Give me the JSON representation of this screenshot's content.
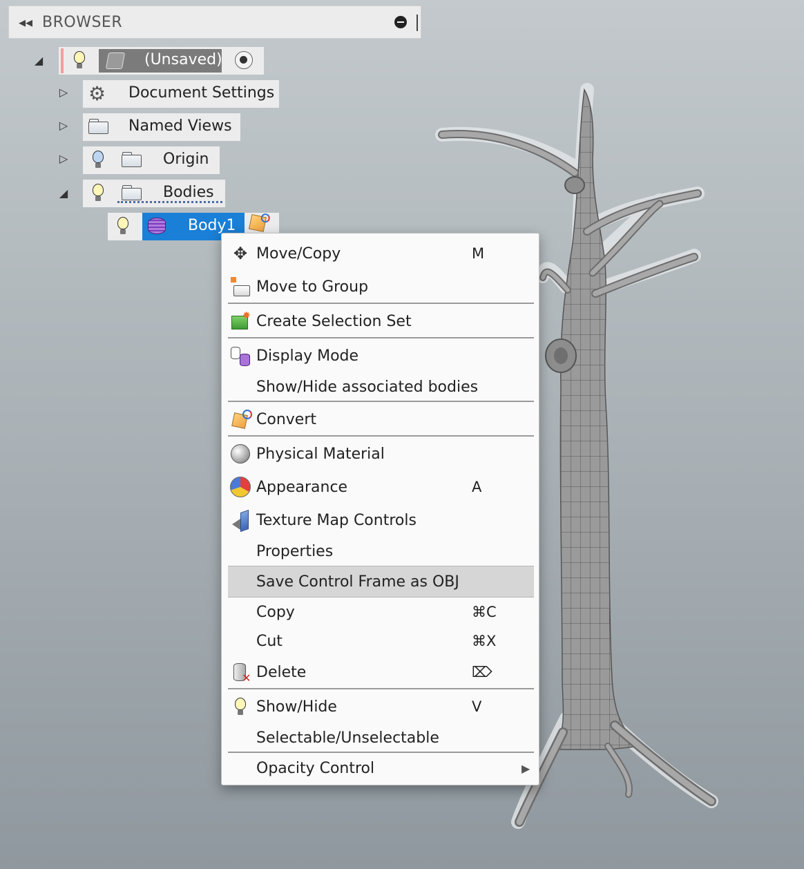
{
  "browser": {
    "collapse_icon": "◂◂",
    "title": "BROWSER"
  },
  "tree": {
    "root": {
      "label": "(Unsaved)"
    },
    "document_settings": {
      "label": "Document Settings"
    },
    "named_views": {
      "label": "Named Views"
    },
    "origin": {
      "label": "Origin"
    },
    "bodies": {
      "label": "Bodies"
    },
    "body1": {
      "label": "Body1"
    }
  },
  "menu": {
    "items": [
      {
        "label": "Move/Copy",
        "shortcut": "M",
        "icon": "move-icon"
      },
      {
        "label": "Move to Group",
        "shortcut": "",
        "icon": "move-to-group-icon"
      },
      {
        "label": "Create Selection Set",
        "shortcut": "",
        "icon": "selection-set-icon"
      },
      {
        "label": "Display Mode",
        "shortcut": "",
        "icon": "display-mode-icon"
      },
      {
        "label": "Show/Hide associated bodies",
        "shortcut": "",
        "icon": ""
      },
      {
        "label": "Convert",
        "shortcut": "",
        "icon": "convert-icon"
      },
      {
        "label": "Physical Material",
        "shortcut": "",
        "icon": "material-icon"
      },
      {
        "label": "Appearance",
        "shortcut": "A",
        "icon": "appearance-icon"
      },
      {
        "label": "Texture Map Controls",
        "shortcut": "",
        "icon": "texture-map-icon"
      },
      {
        "label": "Properties",
        "shortcut": "",
        "icon": ""
      },
      {
        "label": "Save Control Frame as OBJ",
        "shortcut": "",
        "icon": ""
      },
      {
        "label": "Copy",
        "shortcut": "⌘C",
        "icon": ""
      },
      {
        "label": "Cut",
        "shortcut": "⌘X",
        "icon": ""
      },
      {
        "label": "Delete",
        "shortcut": "⌦",
        "icon": "delete-icon"
      },
      {
        "label": "Show/Hide",
        "shortcut": "V",
        "icon": "lightbulb-icon"
      },
      {
        "label": "Selectable/Unselectable",
        "shortcut": "",
        "icon": ""
      },
      {
        "label": "Opacity Control",
        "shortcut": "▶",
        "icon": "submenu-arrow-icon"
      }
    ]
  },
  "colors": {
    "selection": "#1a7fd6",
    "menu_highlight": "#d6d6d6",
    "panel": "#ececec"
  }
}
